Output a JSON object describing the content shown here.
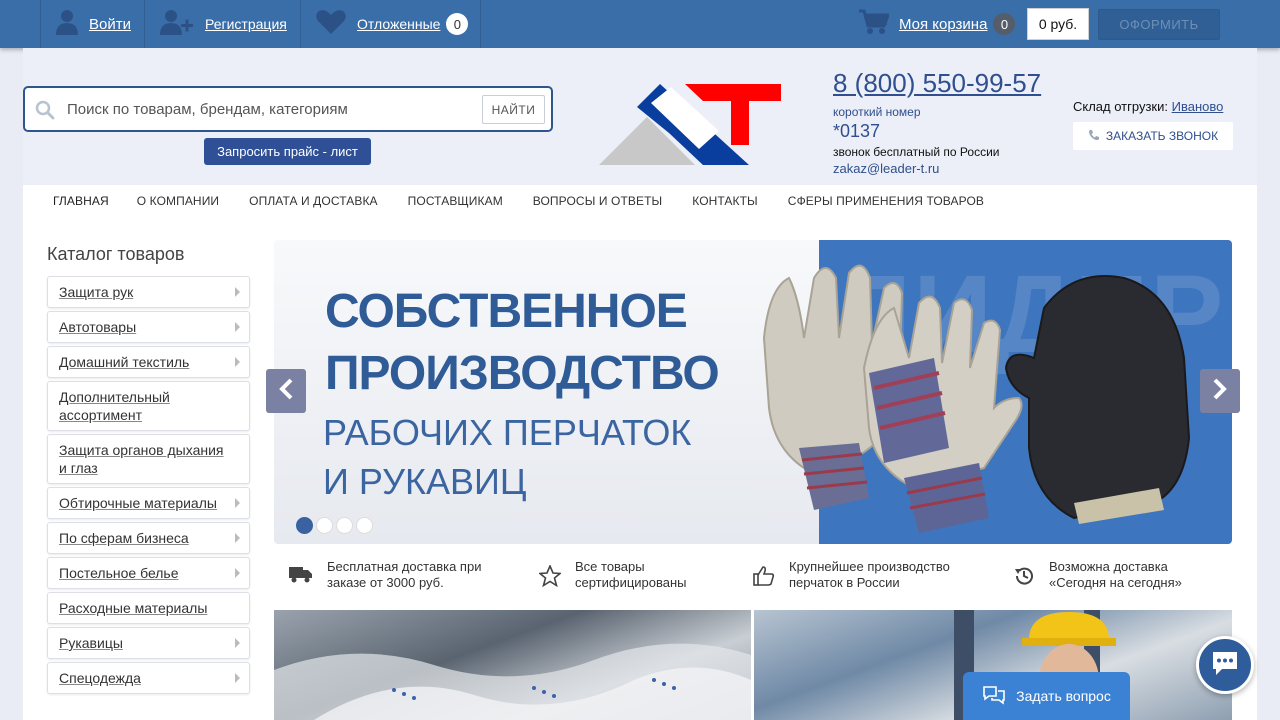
{
  "topbar": {
    "login": "Войти",
    "register": "Регистрация",
    "favorites": "Отложенные",
    "favorites_count": "0",
    "cart": "Моя корзина",
    "cart_count": "0",
    "cart_total": "0 руб.",
    "checkout": "ОФОРМИТЬ"
  },
  "header": {
    "search_placeholder": "Поиск по товарам, брендам, категориям",
    "search_button": "НАЙТИ",
    "price_request": "Запросить прайс - лист",
    "phone": "8 (800) 550-99-57",
    "short_label": "короткий номер",
    "short_number": "*0137",
    "free_call": "звонок бесплатный по России",
    "email": "zakaz@leader-t.ru",
    "warehouse_label": "Склад отгрузки:",
    "warehouse_city": "Иваново",
    "callback": "ЗАКАЗАТЬ ЗВОНОК",
    "logo_colors": {
      "red": "#ff0000",
      "blue": "#0a3e9e",
      "gray": "#c8c8c8"
    }
  },
  "nav": [
    {
      "label": "ГЛАВНАЯ",
      "active": true
    },
    {
      "label": "О КОМПАНИИ"
    },
    {
      "label": "ОПЛАТА И ДОСТАВКА"
    },
    {
      "label": "ПОСТАВЩИКАМ"
    },
    {
      "label": "ВОПРОСЫ И ОТВЕТЫ"
    },
    {
      "label": "КОНТАКТЫ"
    },
    {
      "label": "СФЕРЫ ПРИМЕНЕНИЯ ТОВАРОВ"
    }
  ],
  "catalog": {
    "title": "Каталог товаров",
    "items": [
      {
        "label": "Защита рук",
        "arrow": true
      },
      {
        "label": "Автотовары",
        "arrow": true
      },
      {
        "label": "Домашний текстиль",
        "arrow": true
      },
      {
        "label": "Дополнительный ассортимент",
        "arrow": false
      },
      {
        "label": "Защита органов дыхания и глаз",
        "arrow": false
      },
      {
        "label": "Обтирочные материалы",
        "arrow": true
      },
      {
        "label": "По сферам бизнеса",
        "arrow": true
      },
      {
        "label": "Постельное белье",
        "arrow": true
      },
      {
        "label": "Расходные материалы",
        "arrow": false
      },
      {
        "label": "Рукавицы",
        "arrow": true
      },
      {
        "label": "Спецодежда",
        "arrow": true
      }
    ]
  },
  "banner": {
    "line1": "СОБСТВЕННОЕ",
    "line2": "ПРОИЗВОДСТВО",
    "line3": "РАБОЧИХ ПЕРЧАТОК",
    "line4": "И РУКАВИЦ",
    "bg_text": "ЛИДЕР",
    "slides": 4,
    "active_slide": 1
  },
  "features": [
    {
      "icon": "truck-icon",
      "text": "Бесплатная доставка при заказе от 3000 руб."
    },
    {
      "icon": "star-icon",
      "text": "Все товары сертифицированы"
    },
    {
      "icon": "thumbs-up-icon",
      "text": "Крупнейшее производство перчаток в России"
    },
    {
      "icon": "history-icon",
      "text": "Возможна доставка «Сегодня на сегодня»"
    }
  ],
  "chat": {
    "ask": "Задать вопрос"
  }
}
